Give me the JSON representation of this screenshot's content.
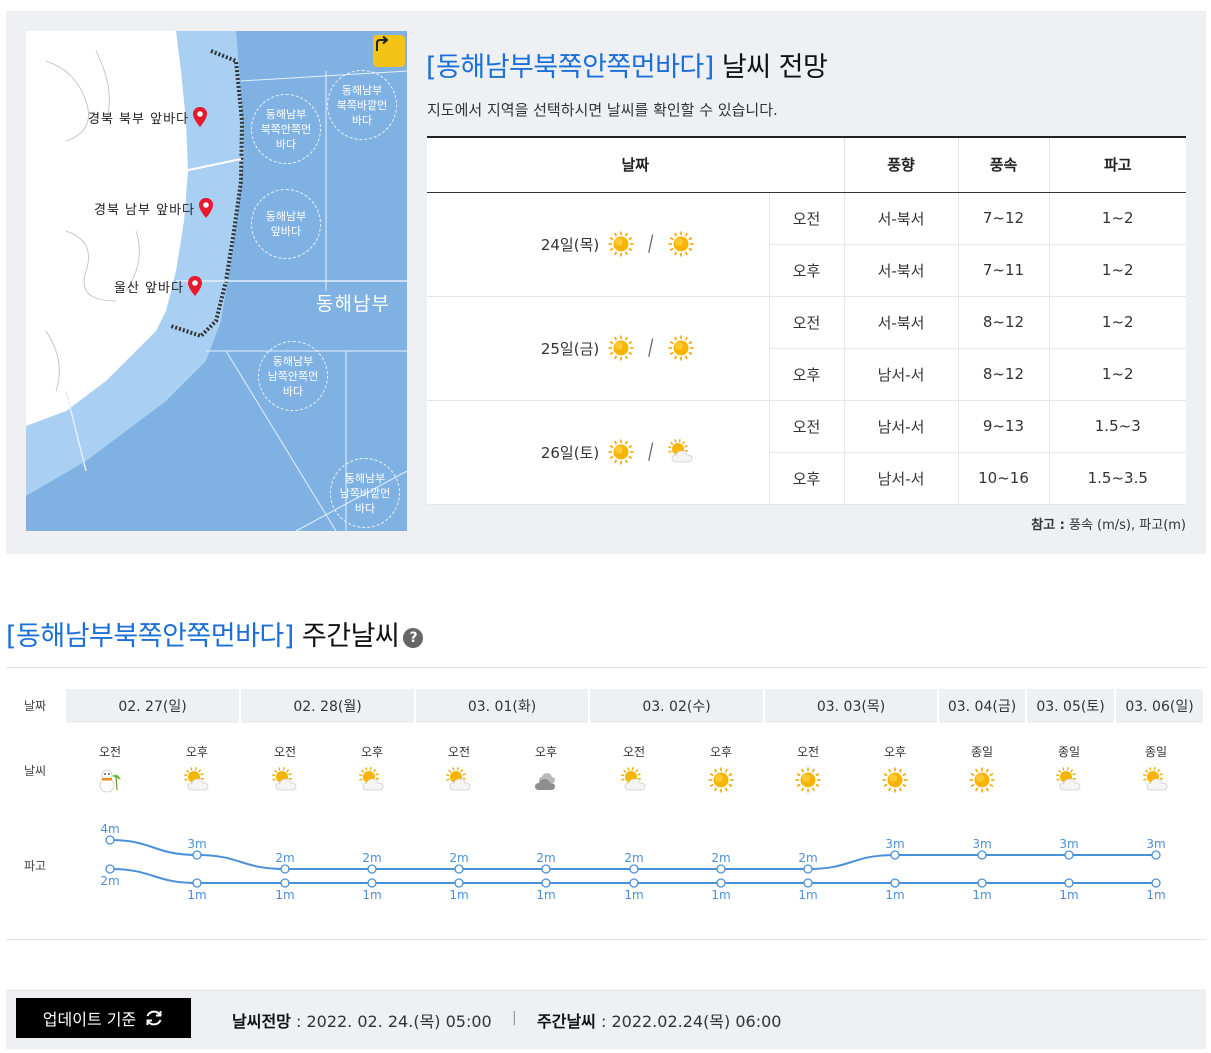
{
  "map": {
    "pins": [
      {
        "label": "경북 북부 앞바다"
      },
      {
        "label": "경북 남부 앞바다"
      },
      {
        "label": "울산 앞바다"
      }
    ],
    "zones": [
      {
        "label": "동해남부\n북쪽안쪽먼\n바다"
      },
      {
        "label": "동해남부\n북쪽바깥먼\n바다"
      },
      {
        "label": "동해남부\n앞바다"
      },
      {
        "label": "동해남부\n남쪽안쪽먼\n바다"
      },
      {
        "label": "동해남부\n남쪽바깥먼\n바다"
      }
    ],
    "sea_name": "동해남부",
    "share_icon": "share-arrow-icon",
    "colors": {
      "sea": "#7fb2e2",
      "coast": "#a9d0f2",
      "land": "#ffffff",
      "pin": "#e8192c",
      "share": "#f3c318"
    }
  },
  "forecast": {
    "region": "[동해남부북쪽안쪽먼바다]",
    "title_suffix": "날씨 전망",
    "description": "지도에서 지역을 선택하시면 날씨를 확인할 수 있습니다.",
    "headers": {
      "date": "날짜",
      "wind_dir": "풍향",
      "wind_speed": "풍속",
      "wave": "파고"
    },
    "days": [
      {
        "date": "24일(목)",
        "am_icon": "sunny",
        "pm_icon": "sunny",
        "rows": [
          {
            "period": "오전",
            "wind_dir": "서-북서",
            "wind_speed": "7~12",
            "wave": "1~2"
          },
          {
            "period": "오후",
            "wind_dir": "서-북서",
            "wind_speed": "7~11",
            "wave": "1~2"
          }
        ]
      },
      {
        "date": "25일(금)",
        "am_icon": "sunny",
        "pm_icon": "sunny",
        "rows": [
          {
            "period": "오전",
            "wind_dir": "서-북서",
            "wind_speed": "8~12",
            "wave": "1~2"
          },
          {
            "period": "오후",
            "wind_dir": "남서-서",
            "wind_speed": "8~12",
            "wave": "1~2"
          }
        ]
      },
      {
        "date": "26일(토)",
        "am_icon": "sunny",
        "pm_icon": "partly-cloudy",
        "rows": [
          {
            "period": "오전",
            "wind_dir": "남서-서",
            "wind_speed": "9~13",
            "wave": "1.5~3"
          },
          {
            "period": "오후",
            "wind_dir": "남서-서",
            "wind_speed": "10~16",
            "wave": "1.5~3.5"
          }
        ]
      }
    ],
    "note_label": "참고 :",
    "note_text": " 풍속 (m/s), 파고(m)"
  },
  "weekly": {
    "region": "[동해남부북쪽안쪽먼바다]",
    "title_suffix": "주간날씨",
    "help_label": "?",
    "row_labels": {
      "date": "날짜",
      "weather": "날씨",
      "wave": "파고"
    },
    "dates": [
      {
        "label": "02. 27(일)",
        "slots": 2
      },
      {
        "label": "02. 28(월)",
        "slots": 2
      },
      {
        "label": "03. 01(화)",
        "slots": 2
      },
      {
        "label": "03. 02(수)",
        "slots": 2
      },
      {
        "label": "03. 03(목)",
        "slots": 2
      },
      {
        "label": "03. 04(금)",
        "slots": 1
      },
      {
        "label": "03. 05(토)",
        "slots": 1
      },
      {
        "label": "03. 06(일)",
        "slots": 1
      }
    ],
    "slots": [
      {
        "period": "오전",
        "icon": "snow-rain",
        "wave_max": 4,
        "wave_min": 2
      },
      {
        "period": "오후",
        "icon": "partly-cloudy",
        "wave_max": 3,
        "wave_min": 1
      },
      {
        "period": "오전",
        "icon": "partly-cloudy",
        "wave_max": 2,
        "wave_min": 1
      },
      {
        "period": "오후",
        "icon": "partly-cloudy",
        "wave_max": 2,
        "wave_min": 1
      },
      {
        "period": "오전",
        "icon": "partly-cloudy",
        "wave_max": 2,
        "wave_min": 1
      },
      {
        "period": "오후",
        "icon": "cloudy",
        "wave_max": 2,
        "wave_min": 1
      },
      {
        "period": "오전",
        "icon": "partly-cloudy",
        "wave_max": 2,
        "wave_min": 1
      },
      {
        "period": "오후",
        "icon": "sunny",
        "wave_max": 2,
        "wave_min": 1
      },
      {
        "period": "오전",
        "icon": "sunny",
        "wave_max": 2,
        "wave_min": 1
      },
      {
        "period": "오후",
        "icon": "sunny",
        "wave_max": 3,
        "wave_min": 1
      },
      {
        "period": "종일",
        "icon": "sunny",
        "wave_max": 3,
        "wave_min": 1
      },
      {
        "period": "종일",
        "icon": "partly-cloudy",
        "wave_max": 3,
        "wave_min": 1
      },
      {
        "period": "종일",
        "icon": "partly-cloudy",
        "wave_max": 3,
        "wave_min": 1
      }
    ],
    "wave_unit": "m",
    "line_color": "#4a90d9"
  },
  "update": {
    "button_label": "업데이트 기준",
    "refresh_icon": "refresh-icon",
    "forecast_label": "날씨전망",
    "forecast_time": " : 2022. 02. 24.(목) 05:00",
    "separator": "|",
    "weekly_label": "주간날씨",
    "weekly_time": " : 2022.02.24(목) 06:00"
  }
}
